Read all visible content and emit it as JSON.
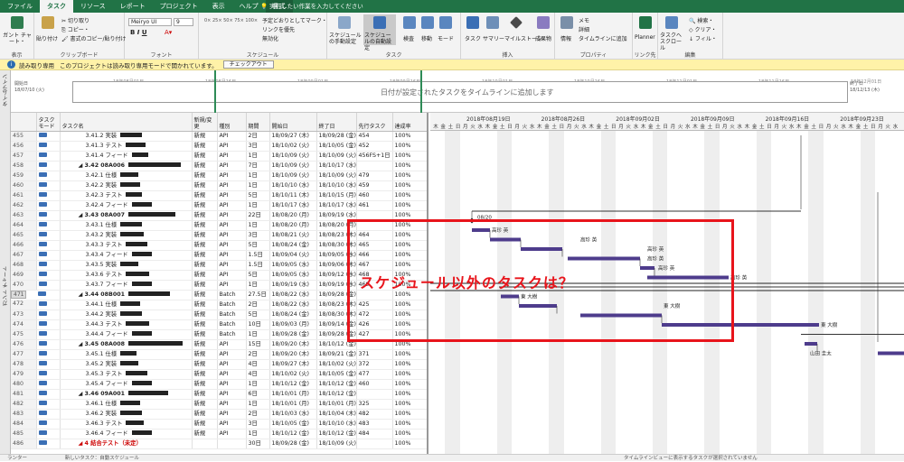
{
  "tabs": [
    {
      "label": "ファイル",
      "active": false
    },
    {
      "label": "タスク",
      "active": true
    },
    {
      "label": "リソース",
      "active": false
    },
    {
      "label": "レポート",
      "active": false
    },
    {
      "label": "プロジェクト",
      "active": false
    },
    {
      "label": "表示",
      "active": false
    },
    {
      "label": "ヘルプ",
      "active": false
    },
    {
      "label": "書式",
      "active": false
    }
  ],
  "tell_me": "実行したい作業を入力してください",
  "ribbon": {
    "groups": [
      "表示",
      "クリップボード",
      "フォント",
      "スケジュール",
      "タスク",
      "挿入",
      "プロパティ",
      "リンク先",
      "編集"
    ],
    "gantt_chart_label": "ガント チャート・",
    "paste_label": "貼り付け",
    "cut_label": "切り取り",
    "copy_label": "コピー・",
    "format_painter_label": "書式のコピー/貼り付け",
    "font_name": "Meiryo UI",
    "font_size": "9",
    "mark_on_track_label": "予定どおりとしてマーク・",
    "respect_links_label": "リンクを優先",
    "inactivate_label": "無効化",
    "manual_schedule_label": "スケジュールの手動設定",
    "auto_schedule_label": "スケジュールの自動設定",
    "inspect_label": "検査",
    "move_label": "移動",
    "mode_label": "モード",
    "task_label": "タスク",
    "summary_label": "サマリー",
    "milestone_label": "マイルストーン",
    "deliverable_label": "成果物",
    "info_label": "情報",
    "notes_label": "メモ",
    "details_label": "詳細",
    "add_to_timeline_label": "タイムラインに追加",
    "planner_label": "Planner",
    "scroll_to_task_label": "タスクへスクロール",
    "find_label": "検索・",
    "clear_label": "クリア・",
    "fill_label": "フィル・"
  },
  "message_bar": {
    "label": "読み取り専用",
    "text": "このプロジェクトは読み取り専用モードで開かれています。",
    "button": "チェックアウト"
  },
  "timeline": {
    "side_label": "タイムライン",
    "start_label": "開始日",
    "start_date": "18/07/10 (火)",
    "finish_label": "終了日",
    "finish_date": "18/12/13 (木)",
    "ticks": [
      "18年08月01日",
      "18年08月16日",
      "18年09月01日",
      "18年09月16日",
      "18年10月01日",
      "18年10月16日",
      "18年11月01日",
      "18年11月16日",
      "18年12月01日"
    ],
    "placeholder": "日付が設定されたタスクをタイムラインに追加します",
    "today_marker": "今日"
  },
  "gantt_side_label": "ガント チャート",
  "columns": [
    "",
    "タスク モード",
    "タスク名",
    "新規/変更",
    "種別",
    "期間",
    "開始日",
    "終了日",
    "先行タスク",
    "達成率"
  ],
  "rows": [
    {
      "id": "455",
      "name": "3.41.2 実装",
      "type": "新規",
      "kind": "API",
      "dur": "2日",
      "start": "18/09/27 (木)",
      "finish": "18/09/28 (金)",
      "pred": "454",
      "pct": "100%"
    },
    {
      "id": "456",
      "name": "3.41.3 テスト",
      "type": "新規",
      "kind": "API",
      "dur": "3日",
      "start": "18/10/02 (火)",
      "finish": "18/10/05 (金)",
      "pred": "452",
      "pct": "100%"
    },
    {
      "id": "457",
      "name": "3.41.4 フィード",
      "type": "新規",
      "kind": "API",
      "dur": "1日",
      "start": "18/10/09 (火)",
      "finish": "18/10/09 (火)",
      "pred": "456FS+1日",
      "pct": "100%"
    },
    {
      "id": "458",
      "name": "◢ 3.42 08A006",
      "type": "新規",
      "kind": "API",
      "dur": "7日",
      "start": "18/10/09 (火)",
      "finish": "18/10/17 (水)",
      "pred": "",
      "pct": "100%",
      "summary": true
    },
    {
      "id": "459",
      "name": "3.42.1 仕様",
      "type": "新規",
      "kind": "API",
      "dur": "1日",
      "start": "18/10/09 (火)",
      "finish": "18/10/09 (火)",
      "pred": "479",
      "pct": "100%"
    },
    {
      "id": "460",
      "name": "3.42.2 実装",
      "type": "新規",
      "kind": "API",
      "dur": "1日",
      "start": "18/10/10 (水)",
      "finish": "18/10/10 (水)",
      "pred": "459",
      "pct": "100%"
    },
    {
      "id": "461",
      "name": "3.42.3 テスト",
      "type": "新規",
      "kind": "API",
      "dur": "5日",
      "start": "18/10/11 (木)",
      "finish": "18/10/15 (月)",
      "pred": "460",
      "pct": "100%"
    },
    {
      "id": "462",
      "name": "3.42.4 フィード",
      "type": "新規",
      "kind": "API",
      "dur": "1日",
      "start": "18/10/17 (水)",
      "finish": "18/10/17 (水)",
      "pred": "461",
      "pct": "100%"
    },
    {
      "id": "463",
      "name": "◢ 3.43 08A007",
      "type": "新規",
      "kind": "API",
      "dur": "22日",
      "start": "18/08/20 (月)",
      "finish": "18/09/19 (水)",
      "pred": "",
      "pct": "100%",
      "summary": true
    },
    {
      "id": "464",
      "name": "3.43.1 仕様",
      "type": "新規",
      "kind": "API",
      "dur": "1日",
      "start": "18/08/20 (月)",
      "finish": "18/08/20 (月)",
      "pred": "",
      "pct": "100%"
    },
    {
      "id": "465",
      "name": "3.43.2 実装",
      "type": "新規",
      "kind": "API",
      "dur": "3日",
      "start": "18/08/21 (火)",
      "finish": "18/08/23 (木)",
      "pred": "464",
      "pct": "100%"
    },
    {
      "id": "466",
      "name": "3.43.3 テスト",
      "type": "新規",
      "kind": "API",
      "dur": "5日",
      "start": "18/08/24 (金)",
      "finish": "18/08/30 (木)",
      "pred": "465",
      "pct": "100%"
    },
    {
      "id": "467",
      "name": "3.43.4 フィード",
      "type": "新規",
      "kind": "API",
      "dur": "1.5日",
      "start": "18/09/04 (火)",
      "finish": "18/09/05 (水)",
      "pred": "466",
      "pct": "100%"
    },
    {
      "id": "468",
      "name": "3.43.5 実装",
      "type": "新規",
      "kind": "API",
      "dur": "1.5日",
      "start": "18/09/05 (水)",
      "finish": "18/09/06 (木)",
      "pred": "467",
      "pct": "100%"
    },
    {
      "id": "469",
      "name": "3.43.6 テスト",
      "type": "新規",
      "kind": "API",
      "dur": "5日",
      "start": "18/09/05 (水)",
      "finish": "18/09/12 (水)",
      "pred": "468",
      "pct": "100%"
    },
    {
      "id": "470",
      "name": "3.43.7 フィード",
      "type": "新規",
      "kind": "API",
      "dur": "1日",
      "start": "18/09/19 (水)",
      "finish": "18/09/19 (水)",
      "pred": "469",
      "pct": "100%"
    },
    {
      "id": "471",
      "name": "◢ 3.44 08B001",
      "type": "新規",
      "kind": "Batch",
      "dur": "27.5日",
      "start": "18/08/22 (水)",
      "finish": "18/09/28 (金)",
      "pred": "",
      "pct": "100%",
      "summary": true,
      "selected": true
    },
    {
      "id": "472",
      "name": "3.44.1 仕様",
      "type": "新規",
      "kind": "Batch",
      "dur": "2日",
      "start": "18/08/22 (水)",
      "finish": "18/08/23 (木)",
      "pred": "425",
      "pct": "100%"
    },
    {
      "id": "473",
      "name": "3.44.2 実装",
      "type": "新規",
      "kind": "Batch",
      "dur": "5日",
      "start": "18/08/24 (金)",
      "finish": "18/08/30 (木)",
      "pred": "472",
      "pct": "100%"
    },
    {
      "id": "474",
      "name": "3.44.3 テスト",
      "type": "新規",
      "kind": "Batch",
      "dur": "10日",
      "start": "18/09/03 (月)",
      "finish": "18/09/14 (金)",
      "pred": "426",
      "pct": "100%"
    },
    {
      "id": "475",
      "name": "3.44.4 フィード",
      "type": "新規",
      "kind": "Batch",
      "dur": "1日",
      "start": "18/09/28 (金)",
      "finish": "18/09/28 (金)",
      "pred": "427",
      "pct": "100%"
    },
    {
      "id": "476",
      "name": "◢ 3.45 08A008",
      "type": "新規",
      "kind": "API",
      "dur": "15日",
      "start": "18/09/20 (木)",
      "finish": "18/10/12 (金)",
      "pred": "",
      "pct": "100%",
      "summary": true
    },
    {
      "id": "477",
      "name": "3.45.1 仕様",
      "type": "新規",
      "kind": "API",
      "dur": "2日",
      "start": "18/09/20 (木)",
      "finish": "18/09/21 (金)",
      "pred": "371",
      "pct": "100%"
    },
    {
      "id": "478",
      "name": "3.45.2 実装",
      "type": "新規",
      "kind": "API",
      "dur": "4日",
      "start": "18/09/27 (木)",
      "finish": "18/10/02 (火)",
      "pred": "372",
      "pct": "100%"
    },
    {
      "id": "479",
      "name": "3.45.3 テスト",
      "type": "新規",
      "kind": "API",
      "dur": "4日",
      "start": "18/10/02 (火)",
      "finish": "18/10/05 (金)",
      "pred": "477",
      "pct": "100%"
    },
    {
      "id": "480",
      "name": "3.45.4 フィード",
      "type": "新規",
      "kind": "API",
      "dur": "1日",
      "start": "18/10/12 (金)",
      "finish": "18/10/12 (金)",
      "pred": "460",
      "pct": "100%"
    },
    {
      "id": "481",
      "name": "◢ 3.46 09A001",
      "type": "新規",
      "kind": "API",
      "dur": "6日",
      "start": "18/10/01 (月)",
      "finish": "18/10/12 (金)",
      "pred": "",
      "pct": "100%",
      "summary": true
    },
    {
      "id": "482",
      "name": "3.46.1 仕様",
      "type": "新規",
      "kind": "API",
      "dur": "1日",
      "start": "18/10/01 (月)",
      "finish": "18/10/01 (月)",
      "pred": "325",
      "pct": "100%"
    },
    {
      "id": "483",
      "name": "3.46.2 実装",
      "type": "新規",
      "kind": "API",
      "dur": "2日",
      "start": "18/10/03 (水)",
      "finish": "18/10/04 (木)",
      "pred": "482",
      "pct": "100%"
    },
    {
      "id": "484",
      "name": "3.46.3 テスト",
      "type": "新規",
      "kind": "API",
      "dur": "3日",
      "start": "18/10/05 (金)",
      "finish": "18/10/10 (水)",
      "pred": "483",
      "pct": "100%"
    },
    {
      "id": "485",
      "name": "3.46.4 フィード",
      "type": "新規",
      "kind": "API",
      "dur": "1日",
      "start": "18/10/12 (金)",
      "finish": "18/10/12 (金)",
      "pred": "484",
      "pct": "100%"
    },
    {
      "id": "486",
      "name": "◢ 4 結合テスト（未定）",
      "type": "",
      "kind": "",
      "dur": "30日",
      "start": "18/09/28 (金)",
      "finish": "18/10/09 (火)",
      "pred": "",
      "pct": "100%",
      "summary": true,
      "red": true
    }
  ],
  "gantt": {
    "weeks": [
      "2018年08月19日",
      "2018年08月26日",
      "2018年09月02日",
      "2018年09月09日",
      "2018年09月16日",
      "2018年09月23日"
    ],
    "day_letters": [
      "木",
      "金",
      "土",
      "日",
      "月",
      "火",
      "水",
      "木",
      "金",
      "土",
      "日",
      "月",
      "火",
      "水",
      "木",
      "金",
      "土",
      "日",
      "月",
      "火",
      "水",
      "木",
      "金",
      "土",
      "日",
      "月",
      "火",
      "水",
      "木",
      "金",
      "土",
      "日",
      "月",
      "火",
      "水",
      "木",
      "金",
      "土",
      "日",
      "月",
      "火",
      "水",
      "木",
      "金",
      "土",
      "日",
      "月",
      "火",
      "水",
      "木",
      "金",
      "土",
      "日",
      "月",
      "火",
      "水",
      "木",
      "金",
      "土",
      "日",
      "月",
      "火",
      "水"
    ],
    "milestone_label": "08/20",
    "resource_labels": [
      "高珍 英",
      "高珍 英",
      "高珍 英",
      "高珍 英",
      "高珍 英",
      "高珍 英",
      "東 大樹",
      "東 大樹",
      "東 大樹",
      "山田 圭太"
    ]
  },
  "annotation": "スケジュール以外のタスクは？",
  "status_bar": {
    "mode": "ランター",
    "new_tasks": "新しいタスク：自動スケジュール",
    "right": "タイムラインビューに表示するタスクが選択されていません"
  },
  "colors": {
    "brand": "#217346",
    "bar": "#4e3c8c",
    "annotation": "#e8141b"
  }
}
